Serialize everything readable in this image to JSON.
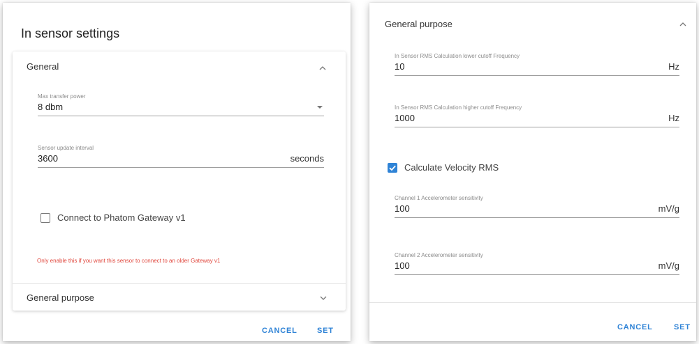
{
  "left_dialog": {
    "title": "In sensor settings",
    "general_panel": {
      "header": "General",
      "header_icon": "chevron-up-icon",
      "max_power": {
        "label": "Max transfer power",
        "value": "8 dbm",
        "icon": "dropdown-caret-icon"
      },
      "update_interval": {
        "label": "Sensor update interval",
        "value": "3600",
        "unit": "seconds"
      },
      "gateway_checkbox": {
        "label": "Connect to Phatom Gateway v1",
        "checked": false
      },
      "warning": "Only enable this if you want this sensor to connect to an older Gateway v1"
    },
    "general_purpose_header": {
      "label": "General purpose",
      "icon": "chevron-down-icon"
    },
    "buttons": {
      "cancel": "CANCEL",
      "set": "SET"
    }
  },
  "right_dialog": {
    "section_header": {
      "label": "General purpose",
      "icon": "chevron-up-icon"
    },
    "lower_cutoff": {
      "label": "In Sensor RMS Calculation lower cutoff Frequency",
      "value": "10",
      "unit": "Hz"
    },
    "higher_cutoff": {
      "label": "In Sensor RMS Calculation higher cutoff Frequency",
      "value": "1000",
      "unit": "Hz"
    },
    "velocity_checkbox": {
      "label": "Calculate Velocity RMS",
      "checked": true
    },
    "channel1": {
      "label": "Channel 1 Accelerometer sensitivity",
      "value": "100",
      "unit": "mV/g"
    },
    "channel2": {
      "label": "Channel 2 Accelerometer sensitivity",
      "value": "100",
      "unit": "mV/g"
    },
    "buttons": {
      "cancel": "CANCEL",
      "set": "SET"
    }
  },
  "colors": {
    "accent": "#2f83d6",
    "warning": "#e0463c"
  }
}
